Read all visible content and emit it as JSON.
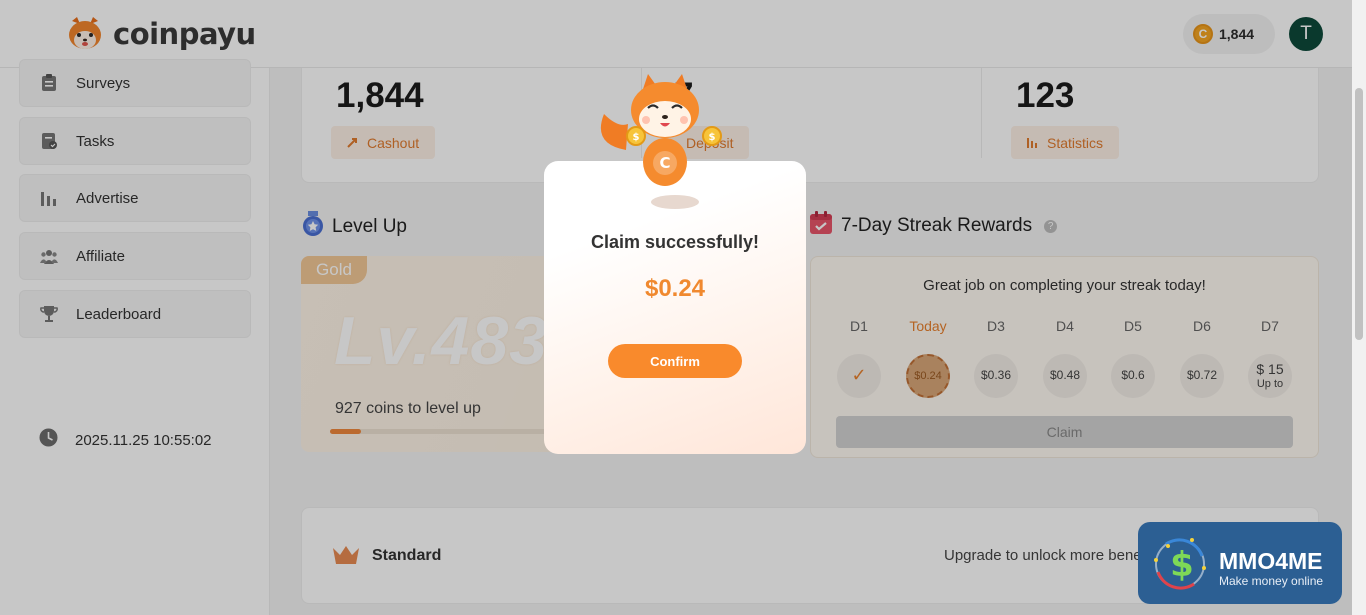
{
  "header": {
    "brand": "coinpayu",
    "coin_symbol": "C",
    "coin_balance": "1,844",
    "avatar_initial": "T"
  },
  "sidebar": {
    "items": [
      {
        "label": "Surveys",
        "icon": "clipboard-icon"
      },
      {
        "label": "Tasks",
        "icon": "tasks-icon"
      },
      {
        "label": "Advertise",
        "icon": "bar-chart-icon"
      },
      {
        "label": "Affiliate",
        "icon": "users-icon"
      },
      {
        "label": "Leaderboard",
        "icon": "trophy-icon"
      }
    ],
    "datetime": "2025.11.25 10:55:02"
  },
  "stats": {
    "balance_value": "1,844",
    "cashout_label": "Cashout",
    "middle_value": "7",
    "deposit_label": "Deposit",
    "right_value": "123",
    "statistics_label": "Statistics"
  },
  "level": {
    "section_title": "Level Up",
    "tier": "Gold",
    "level_text": "Lv.483",
    "coins_to_level": "927 coins to level up",
    "progress_fraction": 0.07
  },
  "streak": {
    "section_title": "7-Day Streak Rewards",
    "help_icon": "?",
    "message": "Great job on completing your streak today!",
    "days": [
      {
        "label": "D1",
        "reward": "✓",
        "state": "done"
      },
      {
        "label": "Today",
        "reward": "$0.24",
        "state": "today"
      },
      {
        "label": "D3",
        "reward": "$0.36",
        "state": "pending"
      },
      {
        "label": "D4",
        "reward": "$0.48",
        "state": "pending"
      },
      {
        "label": "D5",
        "reward": "$0.6",
        "state": "pending"
      },
      {
        "label": "D6",
        "reward": "$0.72",
        "state": "pending"
      },
      {
        "label": "D7",
        "reward": "$ 15",
        "reward_sub": "Up to",
        "state": "pending"
      }
    ],
    "claim_label": "Claim"
  },
  "membership": {
    "plan": "Standard",
    "upgrade_text": "Upgrade to unlock more benefits"
  },
  "modal": {
    "title": "Claim successfully!",
    "amount": "$0.24",
    "confirm_label": "Confirm",
    "mascot_coin_symbol": "C",
    "mascot_small_coin": "$"
  },
  "watermark": {
    "title": "MMO4ME",
    "subtitle": "Make money online"
  },
  "colors": {
    "accent_orange": "#f98a2c",
    "amount_orange": "#f0892f",
    "avatar_green": "#0e4a3a",
    "watermark_blue": "#2c5f93"
  }
}
